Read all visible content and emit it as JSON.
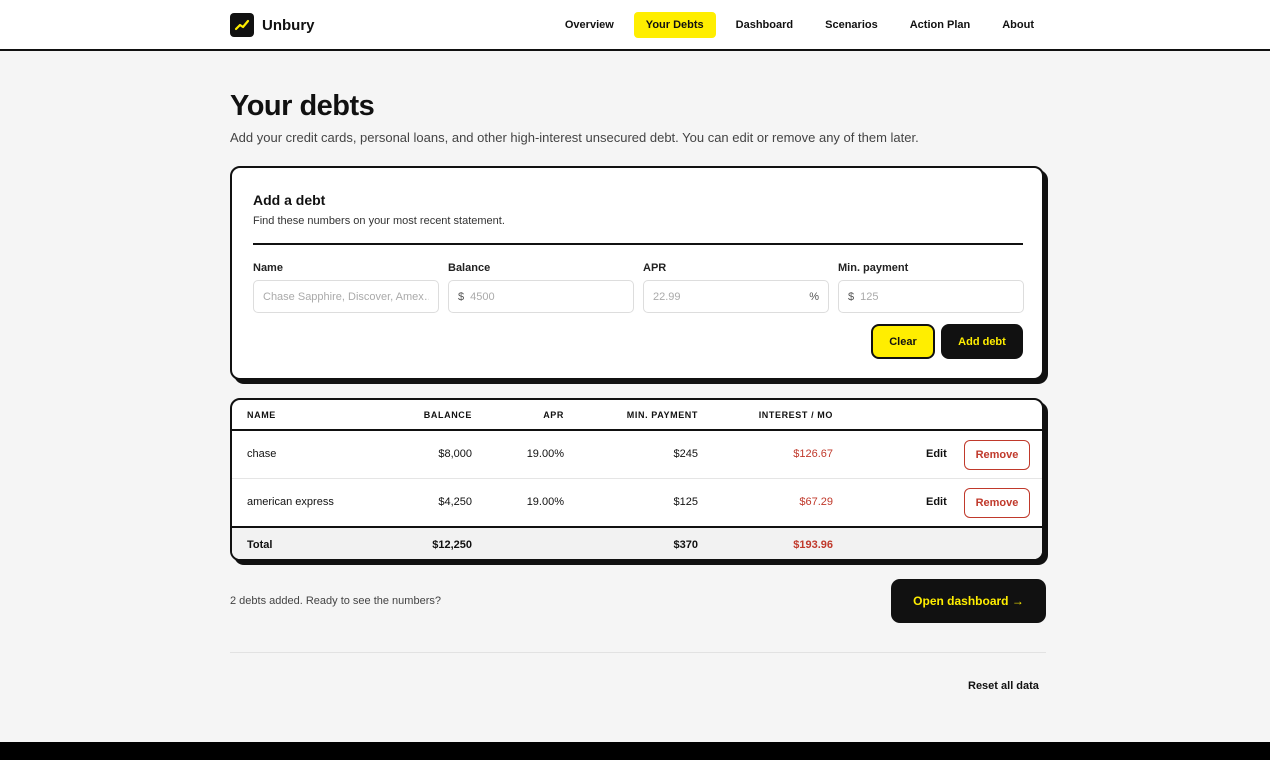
{
  "brand": {
    "name": "Unbury",
    "accent": "#ffee00",
    "icon": "trending-up-icon"
  },
  "nav": {
    "items": [
      {
        "label": "Overview",
        "active": false
      },
      {
        "label": "Your Debts",
        "active": true
      },
      {
        "label": "Dashboard",
        "active": false
      },
      {
        "label": "Scenarios",
        "active": false
      },
      {
        "label": "Action Plan",
        "active": false
      },
      {
        "label": "About",
        "active": false
      }
    ]
  },
  "page": {
    "title": "Your debts",
    "subtitle": "Add your credit cards, personal loans, and other high-interest unsecured debt. You can edit or remove any of them later."
  },
  "add_form": {
    "title": "Add a debt",
    "hint": "Find these numbers on your most recent statement.",
    "name": {
      "label": "Name",
      "placeholder": "Chase Sapphire, Discover, Amex…"
    },
    "balance": {
      "label": "Balance",
      "prefix": "$",
      "placeholder": "4500"
    },
    "apr": {
      "label": "APR",
      "suffix": "%",
      "placeholder": "22.99"
    },
    "min_payment": {
      "label": "Min. payment",
      "prefix": "$",
      "placeholder": "125"
    },
    "clear_label": "Clear",
    "add_label": "Add debt"
  },
  "table": {
    "headers": {
      "name": "NAME",
      "balance": "BALANCE",
      "apr": "APR",
      "min_payment": "MIN. PAYMENT",
      "interest": "INTEREST / MO"
    },
    "rows": [
      {
        "name": "chase",
        "balance": "$8,000",
        "apr": "19.00%",
        "min_payment": "$245",
        "interest": "$126.67",
        "edit": "Edit",
        "remove": "Remove"
      },
      {
        "name": "american express",
        "balance": "$4,250",
        "apr": "19.00%",
        "min_payment": "$125",
        "interest": "$67.29",
        "edit": "Edit",
        "remove": "Remove"
      }
    ],
    "total": {
      "label": "Total",
      "balance": "$12,250",
      "min_payment": "$370",
      "interest": "$193.96"
    },
    "interest_color": "#c0392b"
  },
  "footer": {
    "count_text": "2 debts added. Ready to see the numbers?",
    "dashboard_label": "Open dashboard →",
    "reset_label": "Reset all data"
  }
}
